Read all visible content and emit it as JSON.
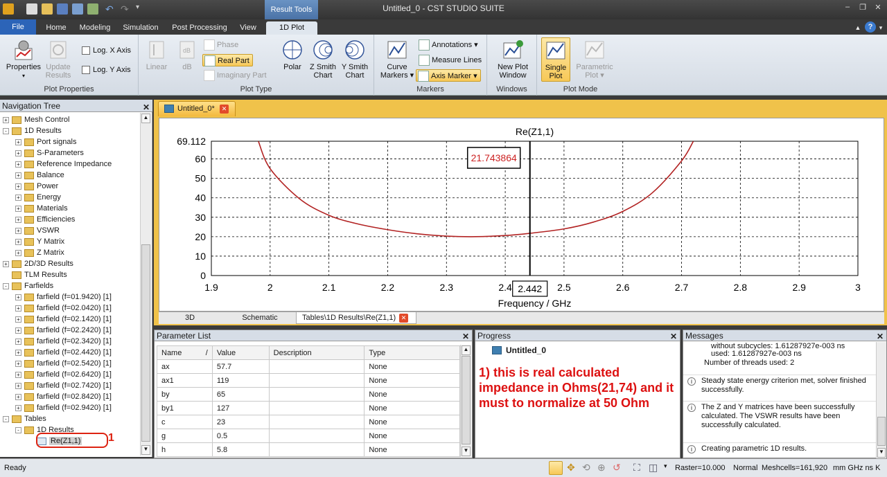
{
  "window": {
    "title": "Untitled_0 - CST STUDIO SUITE",
    "context_tab": "Result Tools"
  },
  "tabs": [
    "File",
    "Home",
    "Modeling",
    "Simulation",
    "Post Processing",
    "View",
    "1D Plot"
  ],
  "ribbon": {
    "properties": {
      "properties": "Properties",
      "update_results_1": "Update",
      "update_results_2": "Results",
      "log_x": "Log. X Axis",
      "log_y": "Log. Y Axis",
      "label": "Plot Properties"
    },
    "plot_type": {
      "linear": "Linear",
      "db": "dB",
      "phase": "Phase",
      "real_part": "Real Part",
      "imaginary_part": "Imaginary Part",
      "polar": "Polar",
      "z_smith_1": "Z Smith",
      "z_smith_2": "Chart",
      "y_smith_1": "Y Smith",
      "y_smith_2": "Chart",
      "label": "Plot Type"
    },
    "markers": {
      "curve_1": "Curve",
      "curve_2": "Markers",
      "annotations": "Annotations",
      "measure_lines": "Measure Lines",
      "axis_marker": "Axis Marker",
      "label": "Markers"
    },
    "windows": {
      "new_plot_1": "New Plot",
      "new_plot_2": "Window",
      "label": "Windows"
    },
    "plot_mode": {
      "single_1": "Single",
      "single_2": "Plot",
      "parametric_1": "Parametric",
      "parametric_2": "Plot",
      "label": "Plot Mode"
    }
  },
  "nav": {
    "title": "Navigation Tree",
    "items": [
      {
        "label": "Mesh Control",
        "level": 0,
        "exp": "+"
      },
      {
        "label": "1D Results",
        "level": 0,
        "exp": "-"
      },
      {
        "label": "Port signals",
        "level": 1,
        "exp": "+"
      },
      {
        "label": "S-Parameters",
        "level": 1,
        "exp": "+"
      },
      {
        "label": "Reference Impedance",
        "level": 1,
        "exp": "+"
      },
      {
        "label": "Balance",
        "level": 1,
        "exp": "+"
      },
      {
        "label": "Power",
        "level": 1,
        "exp": "+"
      },
      {
        "label": "Energy",
        "level": 1,
        "exp": "+"
      },
      {
        "label": "Materials",
        "level": 1,
        "exp": "+"
      },
      {
        "label": "Efficiencies",
        "level": 1,
        "exp": "+"
      },
      {
        "label": "VSWR",
        "level": 1,
        "exp": "+"
      },
      {
        "label": "Y Matrix",
        "level": 1,
        "exp": "+"
      },
      {
        "label": "Z Matrix",
        "level": 1,
        "exp": "+"
      },
      {
        "label": "2D/3D Results",
        "level": 0,
        "exp": "+"
      },
      {
        "label": "TLM Results",
        "level": 0,
        "exp": ""
      },
      {
        "label": "Farfields",
        "level": 0,
        "exp": "-"
      },
      {
        "label": "farfield (f=01.9420) [1]",
        "level": 1,
        "exp": "+"
      },
      {
        "label": "farfield (f=02.0420) [1]",
        "level": 1,
        "exp": "+"
      },
      {
        "label": "farfield (f=02.1420) [1]",
        "level": 1,
        "exp": "+"
      },
      {
        "label": "farfield (f=02.2420) [1]",
        "level": 1,
        "exp": "+"
      },
      {
        "label": "farfield (f=02.3420) [1]",
        "level": 1,
        "exp": "+"
      },
      {
        "label": "farfield (f=02.4420) [1]",
        "level": 1,
        "exp": "+"
      },
      {
        "label": "farfield (f=02.5420) [1]",
        "level": 1,
        "exp": "+"
      },
      {
        "label": "farfield (f=02.6420) [1]",
        "level": 1,
        "exp": "+"
      },
      {
        "label": "farfield (f=02.7420) [1]",
        "level": 1,
        "exp": "+"
      },
      {
        "label": "farfield (f=02.8420) [1]",
        "level": 1,
        "exp": "+"
      },
      {
        "label": "farfield (f=02.9420) [1]",
        "level": 1,
        "exp": "+"
      },
      {
        "label": "Tables",
        "level": 0,
        "exp": "-"
      },
      {
        "label": "1D Results",
        "level": 1,
        "exp": "-"
      },
      {
        "label": "Re(Z1,1)",
        "level": 2,
        "exp": ""
      }
    ],
    "annotation_num": "1"
  },
  "doc_tab": "Untitled_0*",
  "chart_data": {
    "type": "line",
    "title": "Re(Z1,1)",
    "xlabel": "Frequency / GHz",
    "ylabel": "",
    "xlim": [
      1.9,
      3
    ],
    "ylim": [
      0,
      69.112
    ],
    "xticks": [
      "1.9",
      "2",
      "2.1",
      "2.2",
      "2.3",
      "2.4",
      "2.5",
      "2.6",
      "2.7",
      "2.8",
      "2.9",
      "3"
    ],
    "yticks": [
      "0",
      "10",
      "20",
      "30",
      "40",
      "50",
      "60",
      "69.112"
    ],
    "series": [
      {
        "name": "",
        "color": "#b22222",
        "x": [
          1.98,
          2.0,
          2.05,
          2.1,
          2.15,
          2.2,
          2.25,
          2.3,
          2.35,
          2.4,
          2.442,
          2.5,
          2.55,
          2.6,
          2.65,
          2.7,
          2.72
        ],
        "y": [
          69.1,
          55.0,
          39.5,
          31.0,
          26.5,
          23.6,
          21.5,
          20.3,
          20.0,
          20.6,
          21.74,
          24.0,
          27.5,
          33.0,
          42.5,
          59.0,
          69.1
        ]
      }
    ],
    "marker": {
      "x_label": "2.442",
      "value_label": "21.743864"
    },
    "grid": true
  },
  "bottom_tabs": [
    "3D",
    "Schematic",
    "Tables\\1D Results\\Re(Z1,1)"
  ],
  "param_list": {
    "title": "Parameter List",
    "columns": [
      "Name",
      "/",
      "Value",
      "Description",
      "Type"
    ],
    "rows": [
      {
        "name": "ax",
        "value": "57.7",
        "desc": "",
        "type": "None"
      },
      {
        "name": "ax1",
        "value": "119",
        "desc": "",
        "type": "None"
      },
      {
        "name": "by",
        "value": "65",
        "desc": "",
        "type": "None"
      },
      {
        "name": "by1",
        "value": "127",
        "desc": "",
        "type": "None"
      },
      {
        "name": "c",
        "value": "23",
        "desc": "",
        "type": "None"
      },
      {
        "name": "g",
        "value": "0.5",
        "desc": "",
        "type": "None"
      },
      {
        "name": "h",
        "value": "5.8",
        "desc": "",
        "type": "None"
      }
    ]
  },
  "progress": {
    "title": "Progress",
    "item": "Untitled_0",
    "note": "1) this is real calculated impedance in Ohms(21,74) and it must to normalize at 50 Ohm"
  },
  "messages": {
    "title": "Messages",
    "lines": [
      {
        "t": "without subcycles: 1.61287927e-003 ns",
        "icon": false
      },
      {
        "t": "used: 1.61287927e-003 ns",
        "icon": false
      },
      {
        "t": "Number of threads used: 2",
        "icon": false
      },
      {
        "t": "Steady state energy criterion met, solver finished successfully.",
        "icon": true
      },
      {
        "t": "The Z and Y matrices have been successfully calculated. The VSWR results have been successfully calculated.",
        "icon": true
      },
      {
        "t": "Creating parametric 1D results.",
        "icon": true
      }
    ]
  },
  "status": {
    "ready": "Ready",
    "raster": "Raster=10.000",
    "mode": "Normal",
    "meshcells": "Meshcells=161,920",
    "units": "mm  GHz  ns  K"
  }
}
